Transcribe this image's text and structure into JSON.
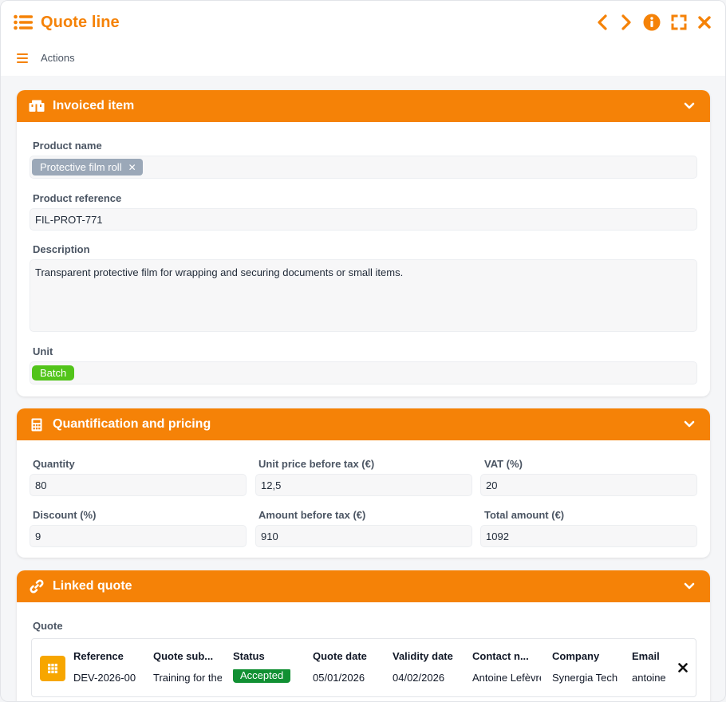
{
  "window": {
    "title": "Quote line",
    "actions_label": "Actions"
  },
  "colors": {
    "accent": "#f58207",
    "chip_grey": "#9ba8b8",
    "unit_green": "#52c41a",
    "status_green": "#119033",
    "grid_icon": "#f7a600"
  },
  "icons": [
    "list-icon",
    "chevron-left-icon",
    "chevron-right-icon",
    "info-icon",
    "fullscreen-icon",
    "close-icon",
    "menu-icon",
    "boxes-icon",
    "calculator-icon",
    "link-icon",
    "chevron-down-icon",
    "grid-icon"
  ],
  "invoiced": {
    "header": "Invoiced item",
    "product_name_label": "Product name",
    "product_name_value": "Protective film roll",
    "product_ref_label": "Product reference",
    "product_ref_value": "FIL-PROT-771",
    "description_label": "Description",
    "description_value": "Transparent protective film for wrapping and securing documents or small items.",
    "unit_label": "Unit",
    "unit_value": "Batch"
  },
  "pricing": {
    "header": "Quantification and pricing",
    "quantity_label": "Quantity",
    "quantity_value": "80",
    "unit_price_label": "Unit price before tax (€)",
    "unit_price_value": "12,5",
    "vat_label": "VAT (%)",
    "vat_value": "20",
    "discount_label": "Discount (%)",
    "discount_value": "9",
    "amount_label": "Amount before tax (€)",
    "amount_value": "910",
    "total_label": "Total amount (€)",
    "total_value": "1092"
  },
  "linked": {
    "header": "Linked quote",
    "quote_label": "Quote",
    "columns": [
      {
        "header": "Reference",
        "value": "DEV-2026-00"
      },
      {
        "header": "Quote sub...",
        "value": "Training for the"
      },
      {
        "header": "Status",
        "value": "Accepted"
      },
      {
        "header": "Quote date",
        "value": "05/01/2026"
      },
      {
        "header": "Validity date",
        "value": "04/02/2026"
      },
      {
        "header": "Contact n...",
        "value": "Antoine Lefèvre"
      },
      {
        "header": "Company",
        "value": "Synergia Tech"
      },
      {
        "header": "Email",
        "value": "antoine"
      }
    ]
  }
}
